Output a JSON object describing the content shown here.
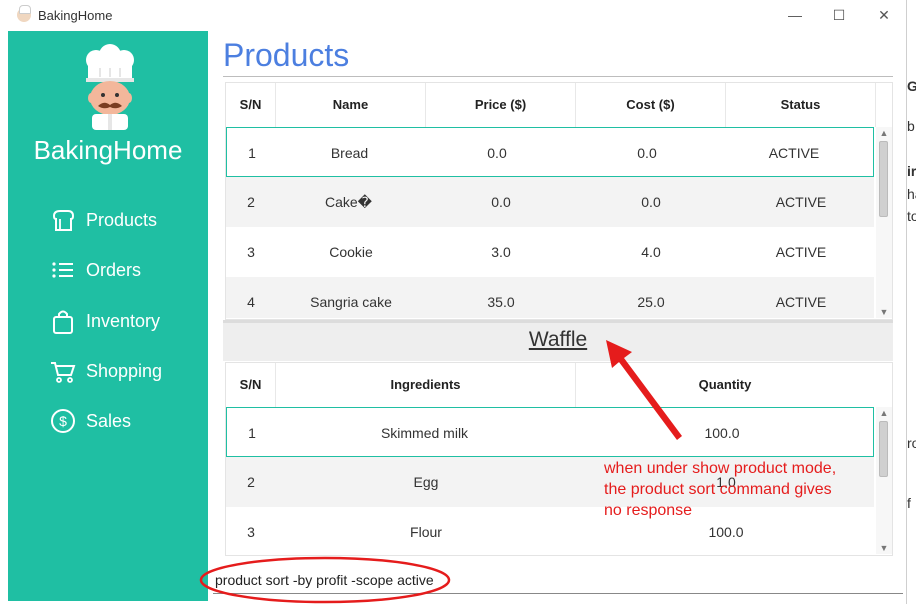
{
  "window": {
    "title": "BakingHome",
    "controls": {
      "minimize": "—",
      "maximize": "☐",
      "close": "✕"
    }
  },
  "sidebar": {
    "brand": "BakingHome",
    "items": [
      {
        "label": "Products",
        "icon": "products-icon"
      },
      {
        "label": "Orders",
        "icon": "orders-icon"
      },
      {
        "label": "Inventory",
        "icon": "inventory-icon"
      },
      {
        "label": "Shopping",
        "icon": "shopping-cart-icon"
      },
      {
        "label": "Sales",
        "icon": "sales-icon"
      }
    ]
  },
  "main": {
    "title": "Products",
    "products_table": {
      "headers": [
        "S/N",
        "Name",
        "Price ($)",
        "Cost ($)",
        "Status"
      ],
      "rows": [
        [
          "1",
          "Bread",
          "0.0",
          "0.0",
          "ACTIVE"
        ],
        [
          "2",
          "Cake�",
          "0.0",
          "0.0",
          "ACTIVE"
        ],
        [
          "3",
          "Cookie",
          "3.0",
          "4.0",
          "ACTIVE"
        ],
        [
          "4",
          "Sangria cake",
          "35.0",
          "25.0",
          "ACTIVE"
        ]
      ]
    },
    "detail": {
      "product_name": "Waffle",
      "ingredients_table": {
        "headers": [
          "S/N",
          "Ingredients",
          "Quantity"
        ],
        "rows": [
          [
            "1",
            "Skimmed milk",
            "100.0"
          ],
          [
            "2",
            "Egg",
            "1.0"
          ],
          [
            "3",
            "Flour",
            "100.0"
          ]
        ]
      }
    },
    "command_input": "product sort -by profit -scope active"
  },
  "annotation": {
    "lines": [
      "when under show product mode,",
      "the product sort command gives",
      "no response"
    ],
    "color": "#e51c1c"
  },
  "right_edge_chars": [
    "G",
    "b",
    "ir",
    "ha",
    "to",
    "ro",
    "f"
  ],
  "colors": {
    "sidebar": "#1fbfa3",
    "title": "#4c7fe0",
    "selection_border": "#1fbfa3"
  }
}
